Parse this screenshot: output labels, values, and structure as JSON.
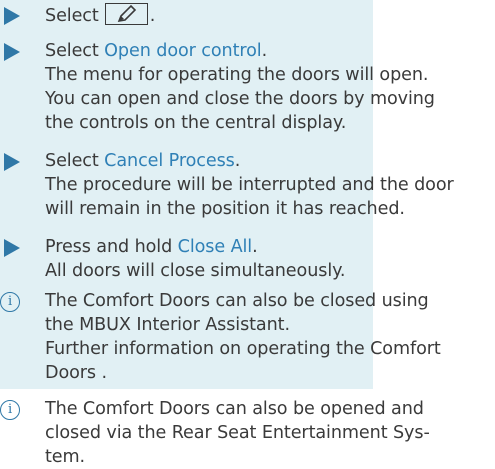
{
  "step1": {
    "text": "Select",
    "after": ".",
    "icon": "pencil-edit-icon"
  },
  "step2": {
    "prefix": "Select ",
    "link": "Open door control",
    "suffix": ".",
    "desc_lines": [
      "The menu for operating the doors will open.",
      "You can open and close the doors by moving",
      "the controls on the central display."
    ]
  },
  "step3": {
    "prefix": "Select ",
    "link": "Cancel Process",
    "suffix": ".",
    "desc_lines": [
      "The procedure will be interrupted and the door",
      "will remain in the position it has reached."
    ]
  },
  "step4": {
    "prefix": "Press and hold ",
    "link": "Close All",
    "suffix": ".",
    "desc_lines": [
      "All doors will close simultaneously."
    ]
  },
  "note1": {
    "lines": [
      "The Comfort Doors can also be closed using",
      "the MBUX Interior Assistant.",
      "Further information on operating the Comfort",
      "Doors ."
    ]
  },
  "note2": {
    "lines": [
      "The Comfort Doors can also be opened and",
      "closed via the Rear Seat Entertainment Sys-",
      "tem."
    ]
  },
  "colors": {
    "accent": "#2f78a7",
    "highlight_bg": "#e1f0f4",
    "text": "#3a3a3a"
  }
}
